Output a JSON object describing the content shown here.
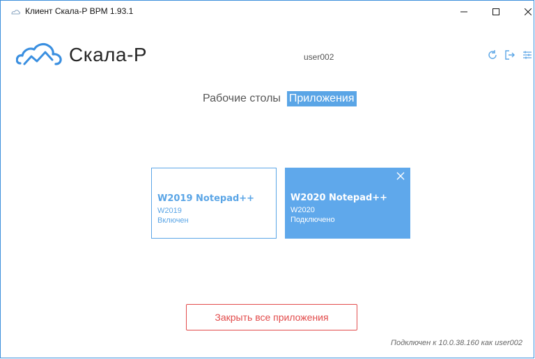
{
  "window": {
    "title": "Клиент Скала-Р ВРМ 1.93.1"
  },
  "header": {
    "brand": "Скала-Р",
    "user": "user002"
  },
  "tabs": [
    {
      "label": "Рабочие столы",
      "active": false
    },
    {
      "label": "Приложения",
      "active": true
    }
  ],
  "apps": [
    {
      "name": "W2019 Notepad++",
      "host": "W2019",
      "status": "Включен",
      "connected": false
    },
    {
      "name": "W2020 Notepad++",
      "host": "W2020",
      "status": "Подключено",
      "connected": true
    }
  ],
  "actions": {
    "close_all": "Закрыть все приложения"
  },
  "status": "Подключен к 10.0.38.160 как user002",
  "icons": {
    "app": "cloud-icon",
    "refresh": "refresh-icon",
    "logout": "logout-icon",
    "settings": "sliders-icon"
  },
  "colors": {
    "accent": "#5aa5e6",
    "danger": "#e24b4b",
    "window_border": "#3c8fdc"
  }
}
